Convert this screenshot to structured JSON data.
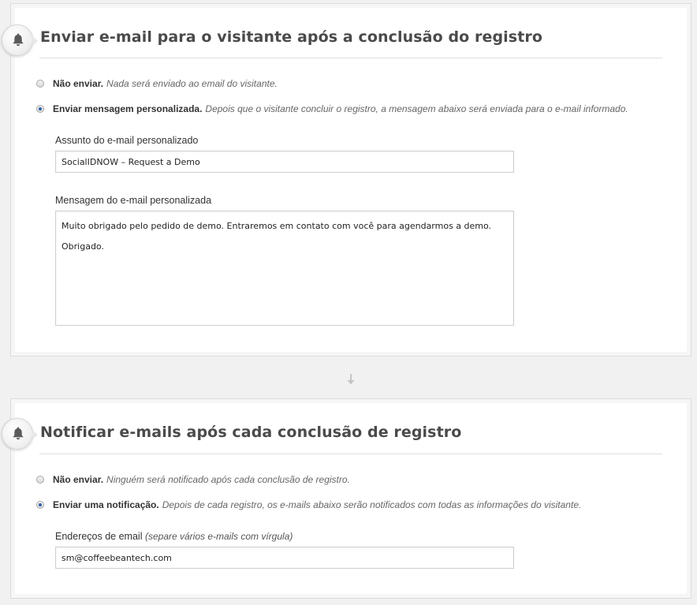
{
  "section1": {
    "title": "Enviar e-mail para o visitante após a conclusão do registro",
    "icon": "bell-icon",
    "options": [
      {
        "label": "Não enviar.",
        "description": "Nada será enviado ao email do visitante.",
        "checked": false
      },
      {
        "label": "Enviar mensagem personalizada.",
        "description": "Depois que o visitante concluir o registro, a mensagem abaixo será enviada para o e-mail informado.",
        "checked": true
      }
    ],
    "subject_label": "Assunto do e-mail personalizado",
    "subject_value": "SocialIDNOW – Request a Demo",
    "message_label": "Mensagem do e-mail personalizada",
    "message_value": "Muito obrigado pelo pedido de demo. Entraremos em contato com você para agendarmos a demo.\nObrigado."
  },
  "connector_icon": "arrow-down-icon",
  "section2": {
    "title": "Notificar e-mails após cada conclusão de registro",
    "icon": "bell-icon",
    "options": [
      {
        "label": "Não enviar.",
        "description": "Ninguém será notificado após cada conclusão de registro.",
        "checked": false
      },
      {
        "label": "Enviar uma notificação.",
        "description": "Depois de cada registro, os e-mails abaixo serão notificados com todas as informações do visitante.",
        "checked": true
      }
    ],
    "emails_label": "Endereços de email",
    "emails_hint": "(separe vários e-mails com vírgula)",
    "emails_value": "sm@coffeebeantech.com"
  },
  "colors": {
    "background": "#f1f1f1",
    "panel": "#ffffff",
    "title": "#4a4a4a",
    "radio_selected": "#2f5fa8"
  }
}
